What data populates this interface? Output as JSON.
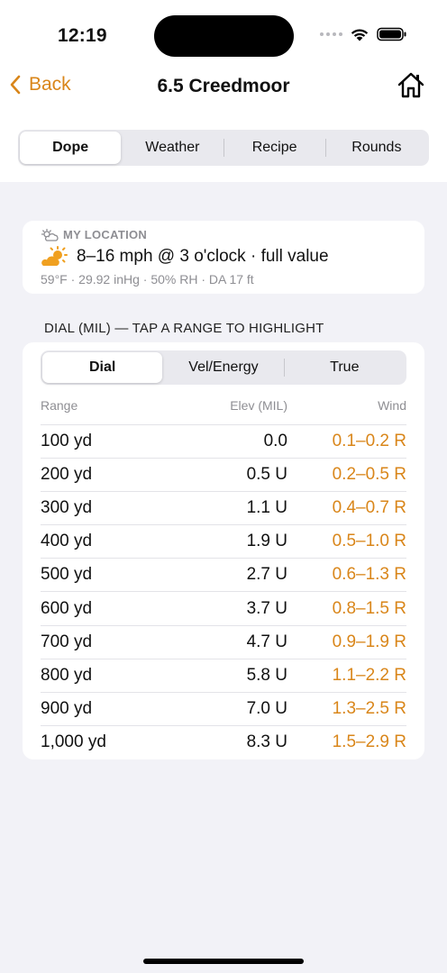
{
  "status_bar": {
    "time": "12:19"
  },
  "nav": {
    "back_label": "Back",
    "title": "6.5 Creedmoor"
  },
  "tabs": [
    {
      "label": "Dope",
      "active": true
    },
    {
      "label": "Weather",
      "active": false
    },
    {
      "label": "Recipe",
      "active": false
    },
    {
      "label": "Rounds",
      "active": false
    }
  ],
  "location": {
    "label": "MY LOCATION",
    "wind": "8–16 mph @ 3 o'clock · full value",
    "conditions": "59°F · 29.92 inHg · 50% RH · DA 17 ft"
  },
  "section_header": "DIAL (MIL) — TAP A RANGE TO HIGHLIGHT",
  "mode_tabs": [
    {
      "label": "Dial",
      "active": true
    },
    {
      "label": "Vel/Energy",
      "active": false
    },
    {
      "label": "True",
      "active": false
    }
  ],
  "table": {
    "headers": {
      "range": "Range",
      "elev": "Elev (MIL)",
      "wind": "Wind"
    },
    "rows": [
      {
        "range": "100 yd",
        "elev": "0.0",
        "wind": "0.1–0.2 R"
      },
      {
        "range": "200 yd",
        "elev": "0.5 U",
        "wind": "0.2–0.5 R"
      },
      {
        "range": "300 yd",
        "elev": "1.1 U",
        "wind": "0.4–0.7 R"
      },
      {
        "range": "400 yd",
        "elev": "1.9 U",
        "wind": "0.5–1.0 R"
      },
      {
        "range": "500 yd",
        "elev": "2.7 U",
        "wind": "0.6–1.3 R"
      },
      {
        "range": "600 yd",
        "elev": "3.7 U",
        "wind": "0.8–1.5 R"
      },
      {
        "range": "700 yd",
        "elev": "4.7 U",
        "wind": "0.9–1.9 R"
      },
      {
        "range": "800 yd",
        "elev": "5.8 U",
        "wind": "1.1–2.2 R"
      },
      {
        "range": "900 yd",
        "elev": "7.0 U",
        "wind": "1.3–2.5 R"
      },
      {
        "range": "1,000 yd",
        "elev": "8.3 U",
        "wind": "1.5–2.9 R"
      }
    ]
  },
  "colors": {
    "accent": "#d9861a",
    "secondary_text": "#8e8e93",
    "background": "#f2f2f7"
  }
}
